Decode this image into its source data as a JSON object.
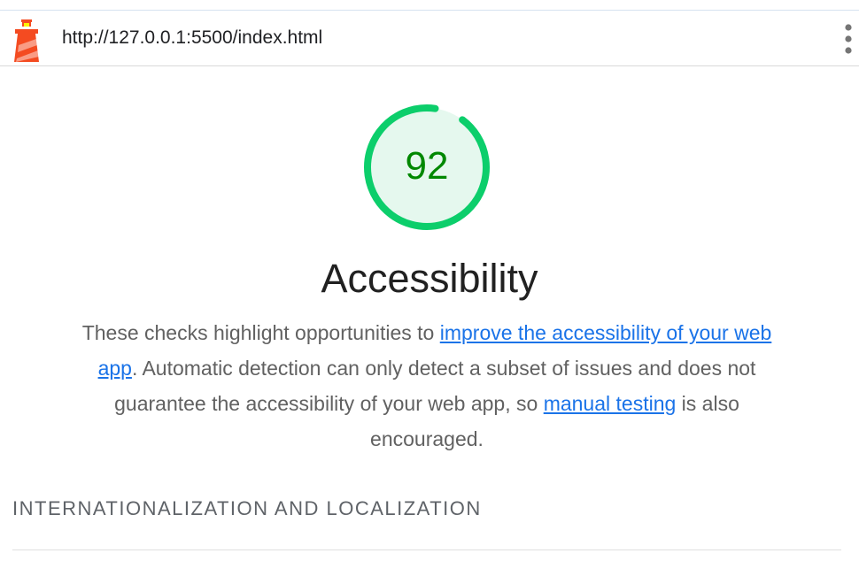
{
  "topbar": {
    "url": "http://127.0.0.1:5500/index.html",
    "logo_icon": "lighthouse-icon",
    "menu_icon": "more-vertical-icon"
  },
  "score": {
    "value": "92",
    "fraction": 0.92,
    "ring_color": "#0cce6b",
    "fill_color": "#e5f8ee",
    "text_color": "#008800"
  },
  "category": {
    "title": "Accessibility",
    "description_part1": "These checks highlight opportunities to ",
    "link1_text": "improve the accessibility of your web app",
    "description_part2": ". Automatic detection can only detect a subset of issues and does not guarantee the accessibility of your web app, so ",
    "link2_text": "manual testing",
    "description_part3": " is also encouraged."
  },
  "section": {
    "title": "INTERNATIONALIZATION AND LOCALIZATION"
  }
}
